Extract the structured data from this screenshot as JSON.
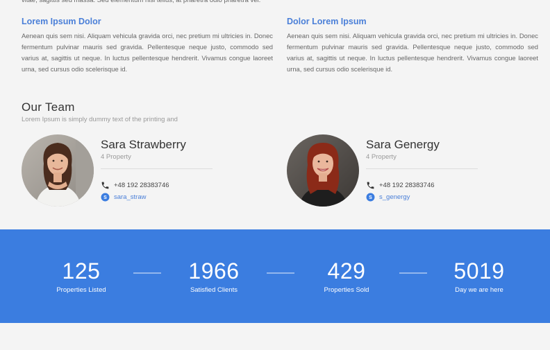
{
  "intro": {
    "top_line": "vitae, sagittis sed massa. Sed elementum nisl tellus, at pharetra odio pharetra vel."
  },
  "columns": [
    {
      "title": "Lorem Ipsum Dolor",
      "text": "Aenean quis sem nisi. Aliquam vehicula gravida orci, nec pretium mi ultricies in. Donec fermentum pulvinar mauris sed gravida. Pellentesque neque justo, commodo sed varius at, sagittis ut neque. In luctus pellentesque hendrerit. Vivamus congue laoreet urna, sed cursus odio scelerisque id."
    },
    {
      "title": "Dolor Lorem Ipsum",
      "text": "Aenean quis sem nisi. Aliquam vehicula gravida orci, nec pretium mi ultricies in. Donec fermentum pulvinar mauris sed gravida. Pellentesque neque justo, commodo sed varius at, sagittis ut neque. In luctus pellentesque hendrerit. Vivamus congue laoreet urna, sed cursus odio scelerisque id."
    }
  ],
  "team": {
    "title": "Our Team",
    "subtitle": "Lorem Ipsum is simply dummy text of the printing and",
    "members": [
      {
        "name": "Sara Strawberry",
        "property": "4 Property",
        "phone": "+48 192 28383746",
        "skype": "sara_straw",
        "icons": {
          "phone": "phone-icon",
          "skype": "skype-icon"
        }
      },
      {
        "name": "Sara Genergy",
        "property": "4 Property",
        "phone": "+48 192 28383746",
        "skype": "s_genergy",
        "icons": {
          "phone": "phone-icon",
          "skype": "skype-icon"
        }
      }
    ]
  },
  "stats": [
    {
      "value": "125",
      "label": "Properties Listed"
    },
    {
      "value": "1966",
      "label": "Satisfied Clients"
    },
    {
      "value": "429",
      "label": "Properties Sold"
    },
    {
      "value": "5019",
      "label": "Day we are here"
    }
  ],
  "colors": {
    "accent": "#4a7fd8",
    "stats_background": "#3b7de0",
    "page_background": "#f4f4f4"
  }
}
